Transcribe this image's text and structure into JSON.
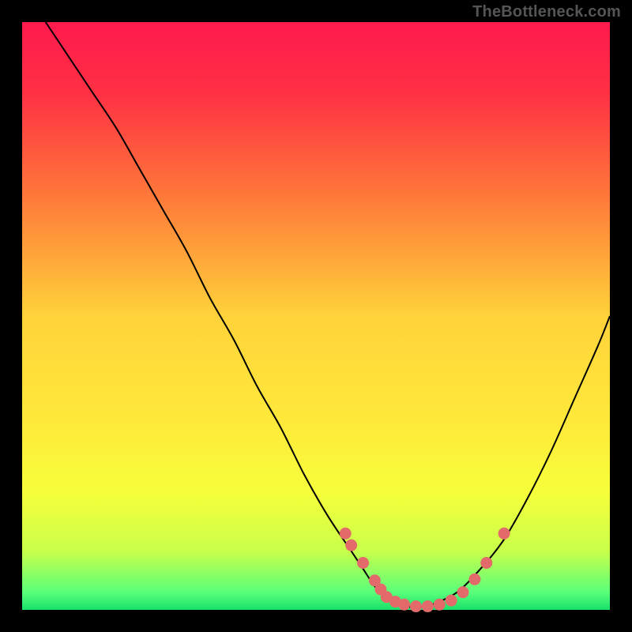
{
  "watermark": "TheBottleneck.com",
  "colors": {
    "frame": "#000000",
    "gradient_stops": [
      {
        "pct": 0,
        "color": "#ff1a4d"
      },
      {
        "pct": 12,
        "color": "#ff3044"
      },
      {
        "pct": 30,
        "color": "#ff7a3a"
      },
      {
        "pct": 50,
        "color": "#ffd23a"
      },
      {
        "pct": 68,
        "color": "#ffe93a"
      },
      {
        "pct": 80,
        "color": "#f6ff3a"
      },
      {
        "pct": 90,
        "color": "#c8ff4a"
      },
      {
        "pct": 97,
        "color": "#5aff7a"
      },
      {
        "pct": 100,
        "color": "#18e06a"
      }
    ],
    "curve": "#000000",
    "dot": "#e26a6a"
  },
  "chart_data": {
    "type": "line",
    "title": "",
    "xlabel": "",
    "ylabel": "",
    "xlim": [
      0,
      100
    ],
    "ylim": [
      0,
      100
    ],
    "grid": false,
    "legend": false,
    "series": [
      {
        "name": "bottleneck-curve",
        "x": [
          4,
          8,
          12,
          16,
          20,
          24,
          28,
          32,
          36,
          40,
          44,
          48,
          52,
          56,
          58,
          60,
          62,
          64,
          66,
          68,
          70,
          74,
          78,
          82,
          86,
          90,
          94,
          98,
          100
        ],
        "y": [
          100,
          94,
          88,
          82,
          75,
          68,
          61,
          53,
          46,
          38,
          31,
          23,
          16,
          10,
          7,
          4,
          2,
          1,
          0.5,
          0.5,
          1,
          3,
          7,
          12,
          19,
          27,
          36,
          45,
          50
        ]
      }
    ],
    "dots": {
      "name": "highlight-dots",
      "x": [
        55,
        56,
        58,
        60,
        61,
        62,
        63.5,
        65,
        67,
        69,
        71,
        73,
        75,
        77,
        79,
        82
      ],
      "y": [
        13,
        11,
        8,
        5,
        3.5,
        2.2,
        1.4,
        0.9,
        0.6,
        0.6,
        0.9,
        1.6,
        3,
        5.2,
        8,
        13
      ]
    }
  }
}
